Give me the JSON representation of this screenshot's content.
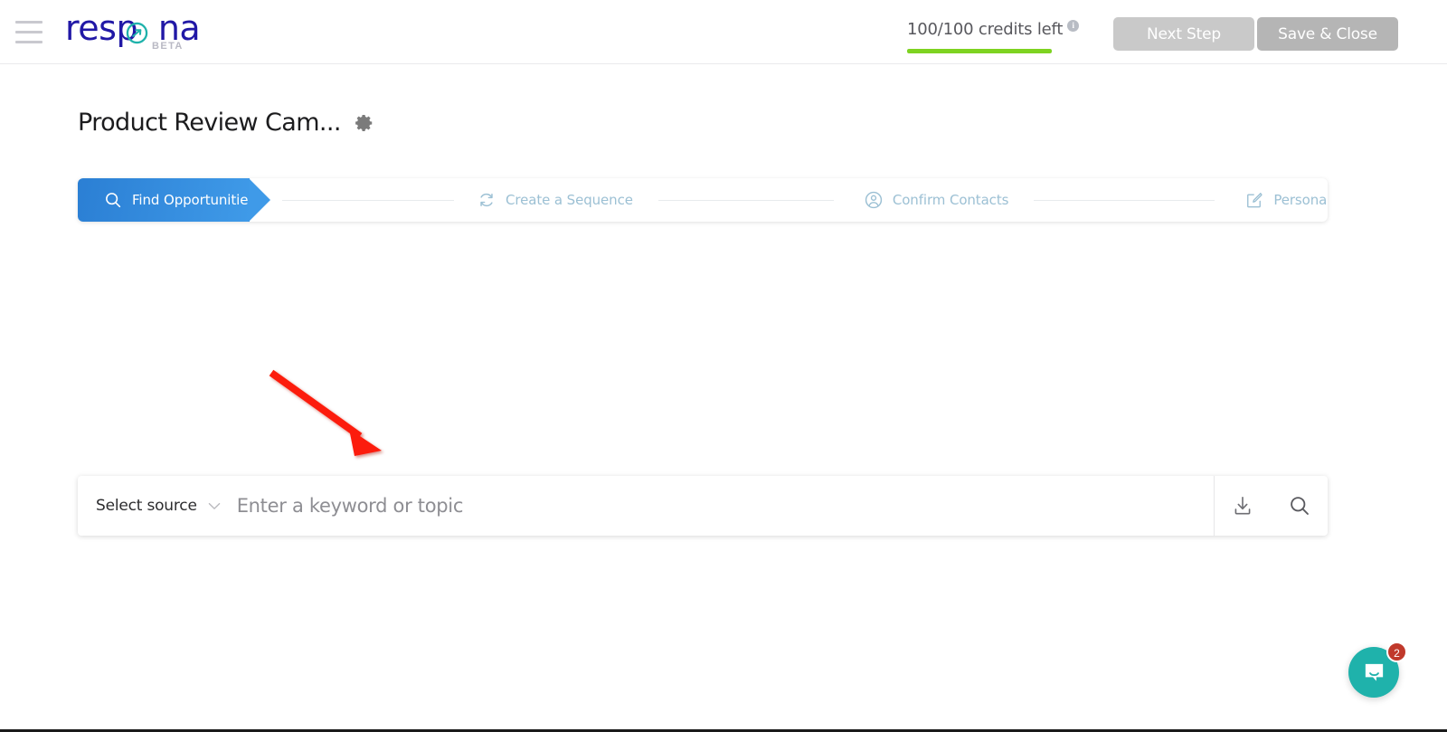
{
  "header": {
    "menu_icon": "hamburger-menu-icon",
    "logo": {
      "text_part1": "resp",
      "text_part2": "na",
      "beta": "BETA",
      "color_primary": "#2118a6",
      "color_accent": "#1fb2ab"
    },
    "credits": {
      "text": "100/100 credits left",
      "info_icon": "info-icon",
      "progress_percent": 100,
      "bar_color": "#7ed321"
    },
    "buttons": [
      {
        "label": "Next Step",
        "name": "next-step-button",
        "color": "#c9c9c9"
      },
      {
        "label": "Save & Close",
        "name": "save-and-close-button",
        "color": "#b5b5b5"
      }
    ]
  },
  "page": {
    "title": "Product Review Cam...",
    "settings_icon": "gear-icon"
  },
  "stepper": {
    "steps": [
      {
        "label": "Find Opportunities",
        "icon": "search-icon",
        "state": "active"
      },
      {
        "label": "Create a Sequence",
        "icon": "refresh-icon",
        "state": "idle"
      },
      {
        "label": "Confirm Contacts",
        "icon": "user-circle-icon",
        "state": "idle"
      },
      {
        "label": "Personalize",
        "icon": "edit-pencil-icon",
        "state": "idle"
      }
    ],
    "active_color_start": "#2b7fd4",
    "active_color_end": "#3f9ae8",
    "idle_color": "#9cc0d4"
  },
  "search": {
    "source_label": "Select source",
    "source_chevron_icon": "chevron-down-icon",
    "keyword_value": "",
    "keyword_placeholder": "Enter a keyword or topic",
    "import_icon": "download-import-icon",
    "search_icon": "search-icon"
  },
  "annotation": {
    "arrow_color": "#fc1c08",
    "arrow_name": "red-pointer-arrow"
  },
  "intercom": {
    "badge_count": "2",
    "icon": "chat-bubble-icon",
    "bubble_color": "#1fb2ab",
    "badge_color": "#c0392b"
  }
}
